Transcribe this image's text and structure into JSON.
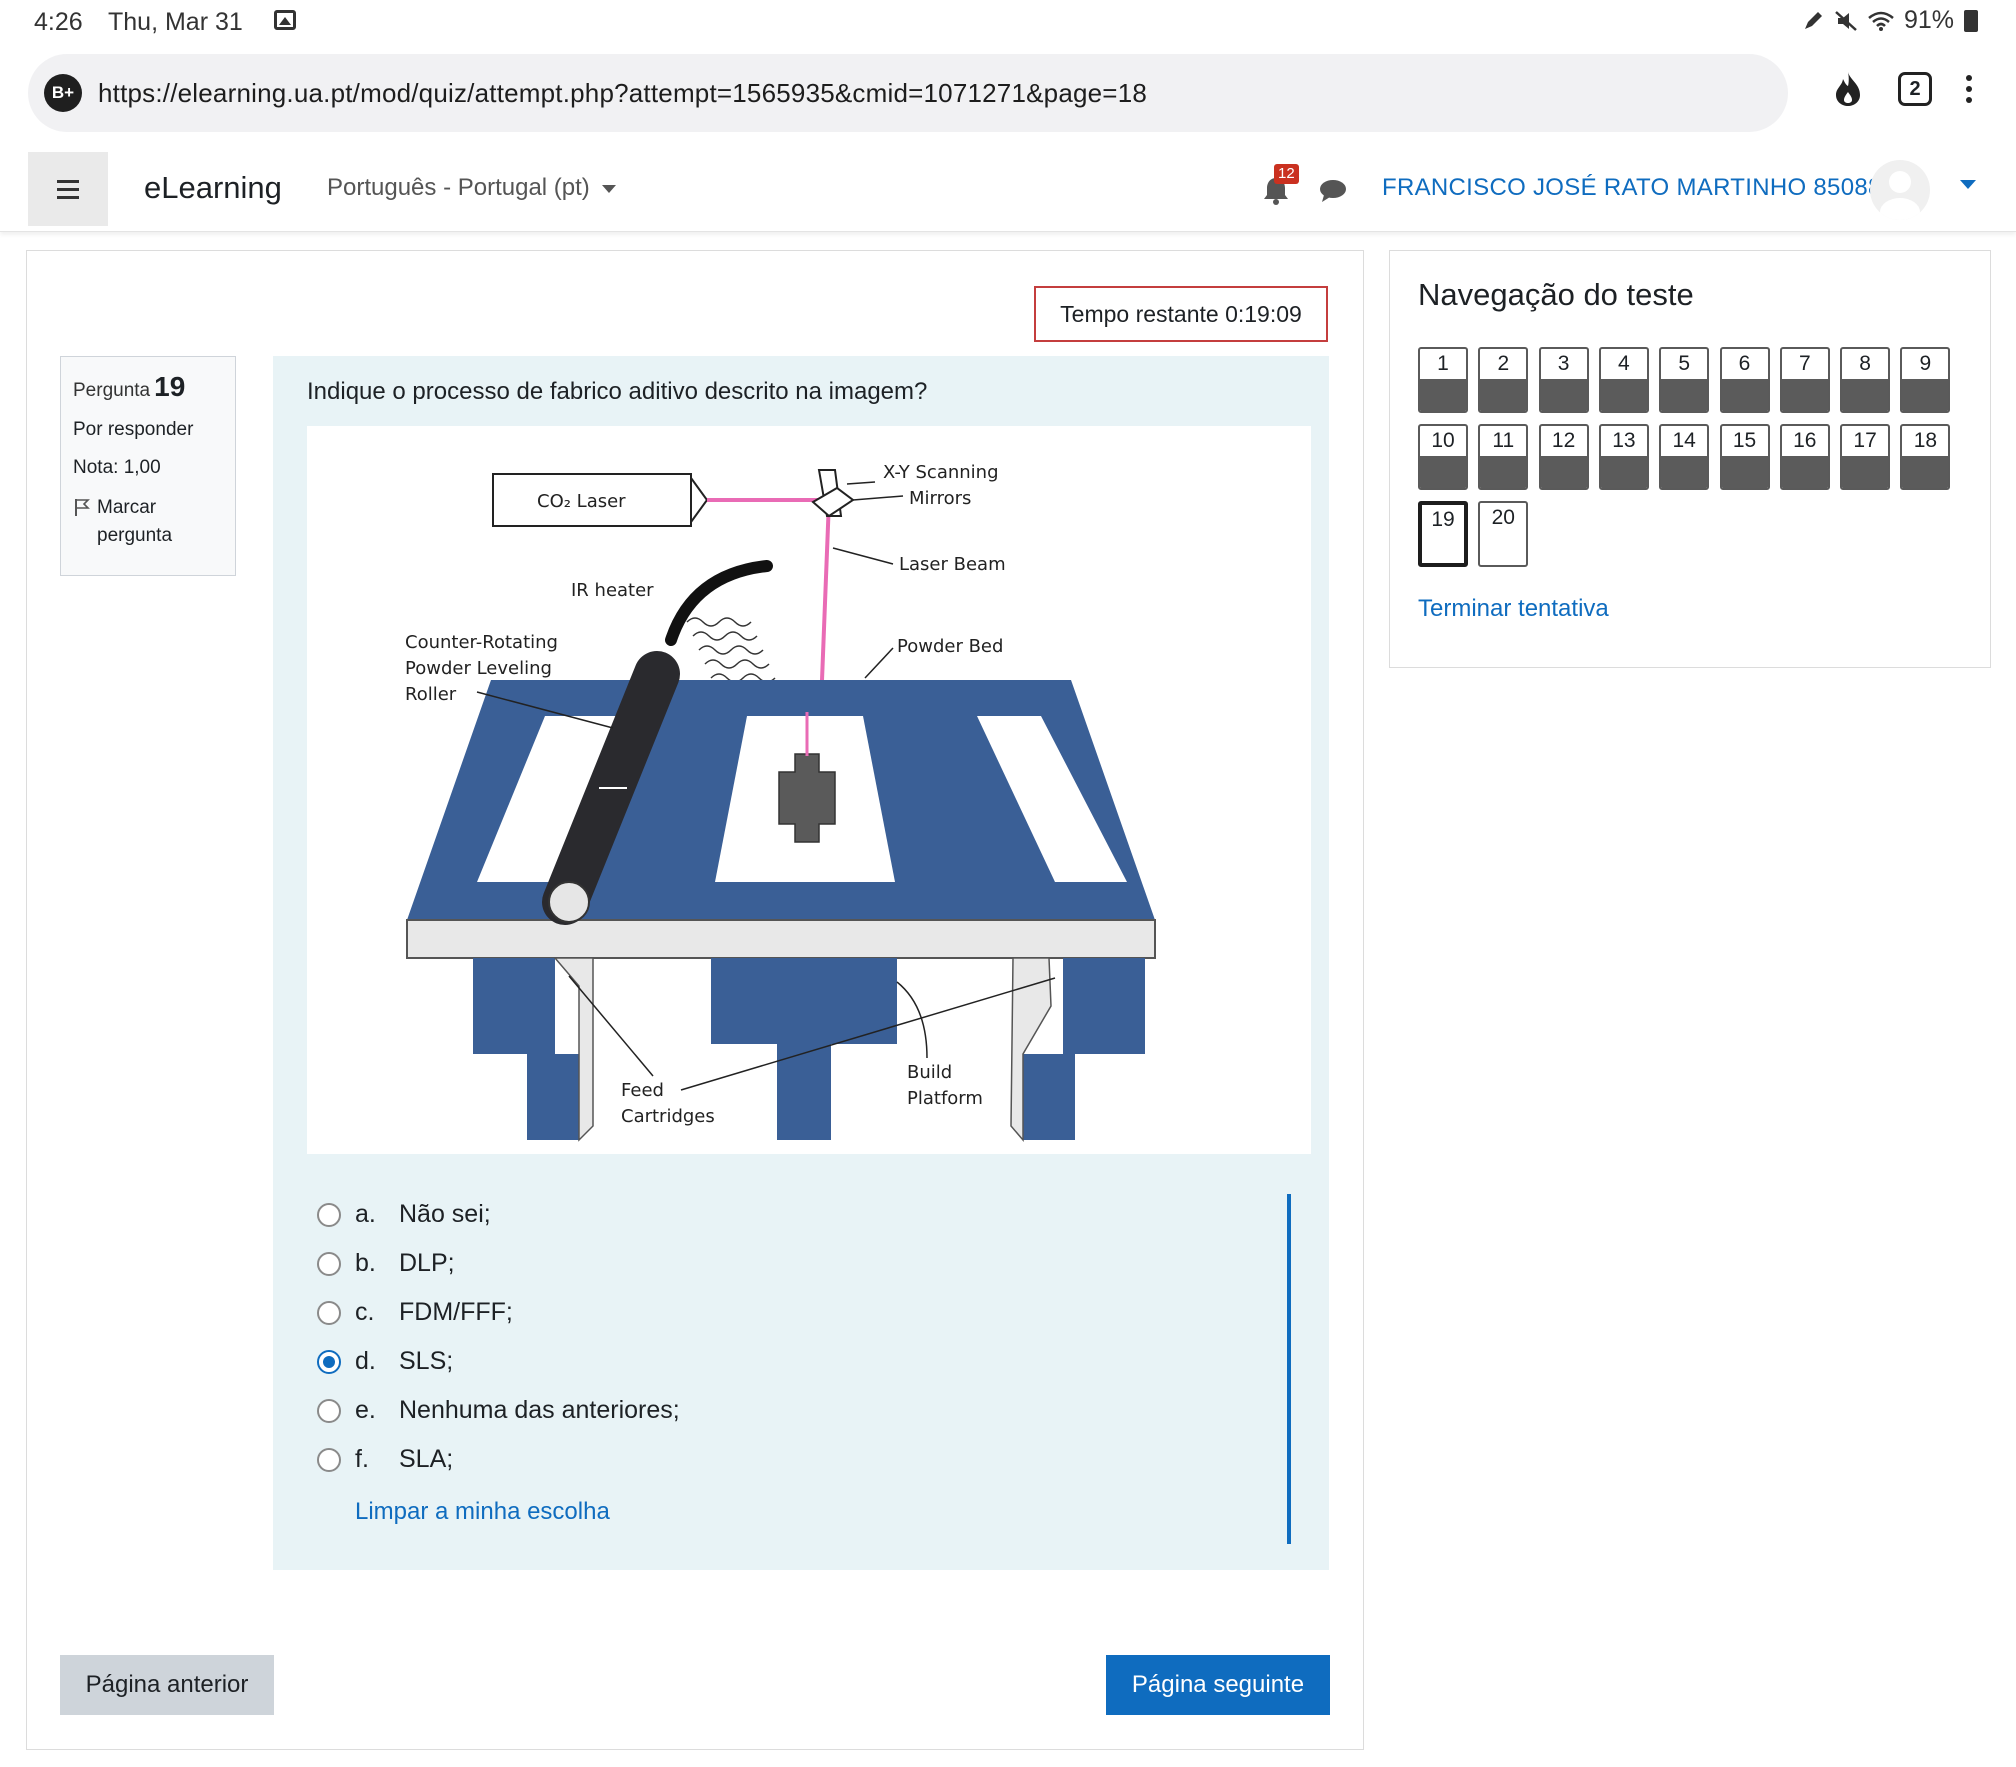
{
  "status": {
    "time": "4:26",
    "date": "Thu, Mar 31",
    "battery": "91%"
  },
  "browser": {
    "site_badge": "B+",
    "url": "https://elearning.ua.pt/mod/quiz/attempt.php?attempt=1565935&cmid=1071271&page=18",
    "tab_count": "2"
  },
  "navbar": {
    "brand": "eLearning",
    "language": "Português - Portugal (pt)",
    "notification_count": "12",
    "user_name": "FRANCISCO JOSÉ RATO MARTINHO 85088"
  },
  "timer": {
    "text": "Tempo restante 0:19:09"
  },
  "question_info": {
    "label": "Pergunta",
    "number": "19",
    "state": "Por responder",
    "grade": "Nota: 1,00",
    "flag_line1": "Marcar",
    "flag_line2": "pergunta"
  },
  "question": {
    "text": "Indique o processo de fabrico aditivo descrito na imagem?",
    "diagram_labels": {
      "co2_laser": "CO₂ Laser",
      "xy_mirrors_1": "X-Y Scanning",
      "xy_mirrors_2": "Mirrors",
      "laser_beam": "Laser Beam",
      "ir_heater": "IR heater",
      "roller_1": "Counter-Rotating",
      "roller_2": "Powder Leveling",
      "roller_3": "Roller",
      "powder_bed": "Powder Bed",
      "feed_1": "Feed",
      "feed_2": "Cartridges",
      "build_1": "Build",
      "build_2": "Platform"
    },
    "answers": [
      {
        "letter": "a.",
        "text": "Não sei;",
        "selected": false
      },
      {
        "letter": "b.",
        "text": "DLP;",
        "selected": false
      },
      {
        "letter": "c.",
        "text": "FDM/FFF;",
        "selected": false
      },
      {
        "letter": "d.",
        "text": "SLS;",
        "selected": true
      },
      {
        "letter": "e.",
        "text": "Nenhuma das anteriores;",
        "selected": false
      },
      {
        "letter": "f.",
        "text": "SLA;",
        "selected": false
      }
    ],
    "clear_choice": "Limpar a minha escolha"
  },
  "buttons": {
    "previous": "Página anterior",
    "next": "Página seguinte"
  },
  "quiz_nav": {
    "title": "Navegação do teste",
    "questions": [
      "1",
      "2",
      "3",
      "4",
      "5",
      "6",
      "7",
      "8",
      "9",
      "10",
      "11",
      "12",
      "13",
      "14",
      "15",
      "16",
      "17",
      "18",
      "19",
      "20"
    ],
    "answered_count": 18,
    "current": "19",
    "finish": "Terminar tentativa"
  },
  "colors": {
    "link": "#0f6cbf",
    "platform_blue": "#3a5f96",
    "laser_pink": "#e96bb5",
    "timer_border": "#c43e3e"
  }
}
